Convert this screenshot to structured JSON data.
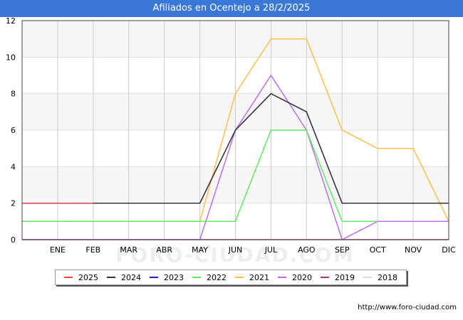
{
  "header": {
    "title": "Afiliados en Ocentejo a 28/2/2025"
  },
  "footer": {
    "url": "http://www.foro-ciudad.com"
  },
  "watermark": "FORO-CIUDAD.COM",
  "chart_data": {
    "type": "line",
    "title": "Afiliados en Ocentejo a 28/2/2025",
    "xlabel": "",
    "ylabel": "",
    "categories": [
      "",
      "ENE",
      "FEB",
      "MAR",
      "ABR",
      "MAY",
      "JUN",
      "JUL",
      "AGO",
      "SEP",
      "OCT",
      "NOV",
      "DIC"
    ],
    "ylim": [
      0,
      12
    ],
    "yticks": [
      0,
      2,
      4,
      6,
      8,
      10,
      12
    ],
    "grid": true,
    "legend_position": "bottom",
    "series": [
      {
        "name": "2025",
        "color": "#ff4040",
        "values": [
          2,
          2,
          2
        ]
      },
      {
        "name": "2024",
        "color": "#333333",
        "values": [
          2,
          2,
          2,
          2,
          2,
          2,
          6,
          8,
          7,
          2,
          2,
          2,
          2
        ]
      },
      {
        "name": "2023",
        "color": "#2222bb",
        "values": [
          2,
          2,
          2,
          2,
          2,
          2,
          6,
          8,
          7,
          2,
          2,
          2,
          2
        ]
      },
      {
        "name": "2022",
        "color": "#55ee55",
        "values": [
          1,
          1,
          1,
          1,
          1,
          1,
          1,
          6,
          6,
          1,
          1,
          null,
          null
        ]
      },
      {
        "name": "2021",
        "color": "#ffbb44",
        "values": [
          1,
          1,
          1,
          1,
          1,
          1,
          8,
          11,
          11,
          6,
          5,
          5,
          1
        ]
      },
      {
        "name": "2020",
        "color": "#bb66ee",
        "values": [
          0,
          0,
          0,
          0,
          0,
          0,
          6,
          9,
          6,
          0,
          1,
          1,
          1
        ]
      },
      {
        "name": "2019",
        "color": "#aa3377",
        "values": [
          0,
          0,
          0,
          0,
          0,
          0,
          0,
          0,
          0,
          0,
          0,
          0,
          0
        ]
      },
      {
        "name": "2018",
        "color": "#dddddd",
        "values": []
      }
    ]
  }
}
